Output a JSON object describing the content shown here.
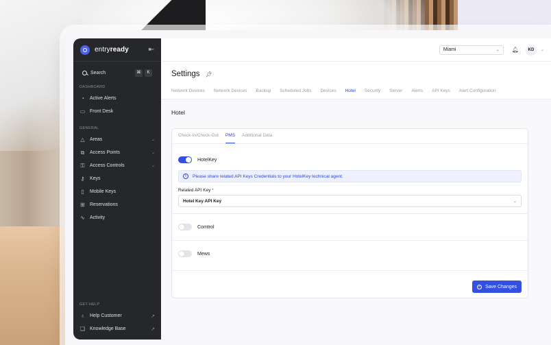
{
  "brand": {
    "name_regular": "entry",
    "name_bold": "ready"
  },
  "search": {
    "placeholder": "Search",
    "shortcut": [
      "⌘",
      "K"
    ]
  },
  "sidebar": {
    "dashboard_label": "DASHBOARD",
    "dashboard_items": [
      {
        "label": "Active Alerts",
        "icon": "alert-circle-icon"
      },
      {
        "label": "Front Desk",
        "icon": "monitor-icon"
      }
    ],
    "general_label": "GENERAL",
    "general_items": [
      {
        "label": "Areas",
        "icon": "areas-icon",
        "expandable": true
      },
      {
        "label": "Access Points",
        "icon": "access-points-icon",
        "expandable": true
      },
      {
        "label": "Access Controls",
        "icon": "access-controls-icon",
        "expandable": true
      },
      {
        "label": "Keys",
        "icon": "key-icon"
      },
      {
        "label": "Mobile Keys",
        "icon": "mobile-icon"
      },
      {
        "label": "Reservations",
        "icon": "reservations-icon"
      },
      {
        "label": "Activity",
        "icon": "activity-icon"
      }
    ],
    "help_label": "GET HELP",
    "help_items": [
      {
        "label": "Help Customer",
        "icon": "lightbulb-icon"
      },
      {
        "label": "Knowledge Base",
        "icon": "book-icon"
      }
    ]
  },
  "topbar": {
    "location": "Miami",
    "user_initials": "KD"
  },
  "page": {
    "title": "Settings"
  },
  "tabs": [
    "Network Devices",
    "Network Devices",
    "Backup",
    "Scheduled Jobs",
    "Devices",
    "Hotel",
    "Security",
    "Server",
    "Alerts",
    "API Keys",
    "Alert Configuration"
  ],
  "active_tab": "Hotel",
  "section": {
    "title": "Hotel"
  },
  "subtabs": [
    "Check-In/Check-Out",
    "PMS",
    "Additional Data"
  ],
  "active_subtab": "PMS",
  "integrations": {
    "hotelkey": {
      "label": "HotelKey",
      "enabled": true,
      "info": "Please share related API Keys Credentials to your HotelKey technical agent.",
      "api_key_label": "Related API Key",
      "api_key_value": "Hotel Key API Key"
    },
    "comtrol": {
      "label": "Comtrol",
      "enabled": false
    },
    "mews": {
      "label": "Mews",
      "enabled": false
    }
  },
  "actions": {
    "save_label": "Save Changes"
  },
  "colors": {
    "accent": "#3550e0",
    "sidebar_bg": "#26272b"
  }
}
